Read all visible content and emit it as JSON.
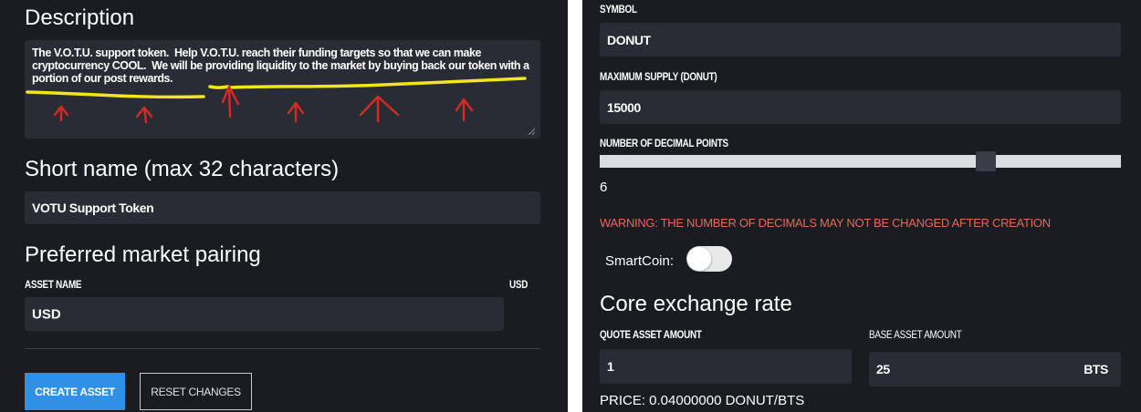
{
  "left": {
    "description_heading": "Description",
    "description_value": "The V.O.T.U. support token.  Help V.O.T.U. reach their funding targets so that we can make cryptocurrency COOL.  We will be providing liquidity to the market by buying back our token with a portion of our post rewards.",
    "short_name_heading": "Short name (max 32 characters)",
    "short_name_value": "VOTU Support Token",
    "market_pairing_heading": "Preferred market pairing",
    "asset_name_label": "ASSET NAME",
    "asset_name_suffix": "USD",
    "asset_name_value": "USD",
    "create_asset_label": "CREATE ASSET",
    "reset_changes_label": "RESET CHANGES"
  },
  "right": {
    "symbol_label": "SYMBOL",
    "symbol_value": "DONUT",
    "max_supply_label": "MAXIMUM SUPPLY (DONUT)",
    "max_supply_value": "15000",
    "decimals_label": "NUMBER OF DECIMAL POINTS",
    "decimals_value": "6",
    "decimals_slider_max": 8,
    "warning_text": "WARNING: THE NUMBER OF DECIMALS MAY NOT BE CHANGED AFTER CREATION",
    "smartcoin_label": "SmartCoin:",
    "smartcoin_enabled": false,
    "core_exchange_heading": "Core exchange rate",
    "quote_amount_label": "QUOTE ASSET AMOUNT",
    "quote_amount_value": "1",
    "base_amount_label": "BASE ASSET AMOUNT",
    "base_amount_value": "25",
    "base_amount_unit": "BTS",
    "price_text": "PRICE: 0.04000000 DONUT/BTS"
  },
  "colors": {
    "panel_bg": "#1b1c22",
    "field_bg": "#2a2c35",
    "primary_button": "#2f90e6",
    "warning": "#e06a5b",
    "annotation_highlight": "#f2e51c",
    "annotation_arrow": "#d42b22"
  },
  "icons": [
    "resize-grip-icon",
    "highlight-annotation",
    "arrow-annotation"
  ]
}
